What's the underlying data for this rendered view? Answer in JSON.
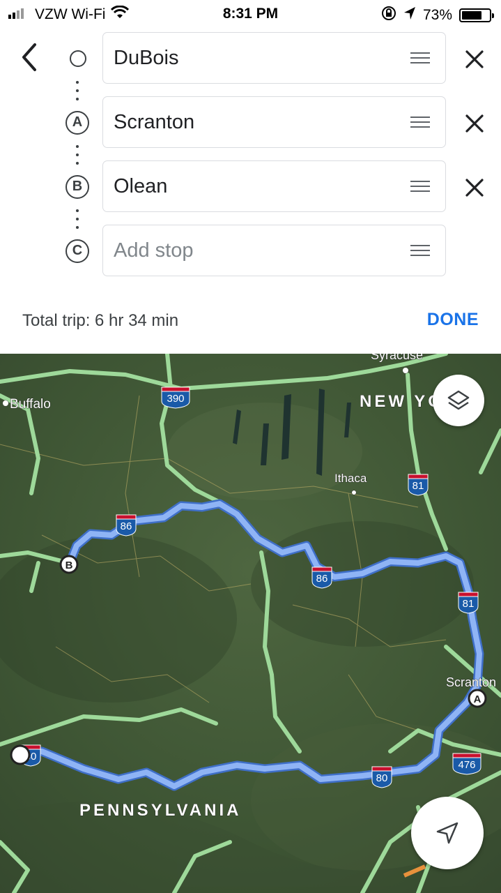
{
  "status_bar": {
    "carrier": "VZW Wi-Fi",
    "time": "8:31 PM",
    "battery": "73%",
    "battery_level": 0.73
  },
  "route": {
    "stops": [
      {
        "marker": "",
        "value": "DuBois"
      },
      {
        "marker": "A",
        "value": "Scranton"
      },
      {
        "marker": "B",
        "value": "Olean"
      }
    ],
    "add_stop": {
      "marker": "C",
      "placeholder": "Add stop"
    }
  },
  "summary": {
    "total_trip": "Total trip: 6 hr 34 min",
    "done_label": "DONE"
  },
  "map": {
    "place_labels": {
      "buffalo": "Buffalo",
      "syracuse": "Syracuse",
      "new_york": "NEW YORK",
      "ithaca": "Ithaca",
      "scranton": "Scranton",
      "pennsylvania": "PENNSYLVANIA"
    },
    "route_shields": {
      "i390": "390",
      "i86_west": "86",
      "i86_east": "86",
      "i81_north": "81",
      "i81_south": "81",
      "i80_east": "80",
      "i80_west": "80",
      "i476": "476"
    },
    "map_markers": {
      "a": "A",
      "b": "B"
    },
    "colors": {
      "route": "#6b9df0",
      "highway": "#9ed99a",
      "interstate_shield": "#1a5aa8"
    }
  },
  "icons": {
    "back": "chevron-left-icon",
    "drag": "drag-handle-icon",
    "remove": "close-icon",
    "layers": "layers-icon",
    "location": "navigation-arrow-icon"
  }
}
